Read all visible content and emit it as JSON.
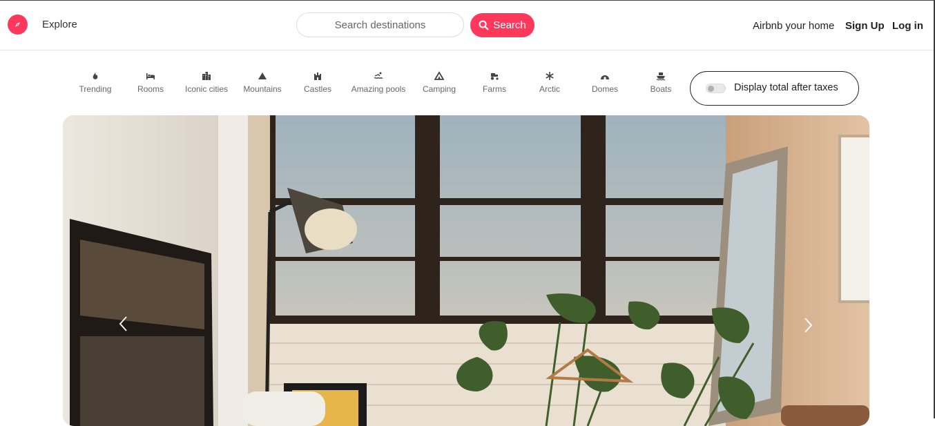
{
  "header": {
    "logo_icon": "compass-icon",
    "explore_label": "Explore",
    "search": {
      "placeholder": "Search destinations",
      "value": "",
      "button_label": "Search",
      "button_icon": "search-icon"
    },
    "host_link": "Airbnb your home",
    "signup_label": "Sign Up",
    "login_label": "Log in"
  },
  "categories": [
    {
      "label": "Trending",
      "icon": "fire-icon"
    },
    {
      "label": "Rooms",
      "icon": "bed-icon"
    },
    {
      "label": "Iconic cities",
      "icon": "city-icon"
    },
    {
      "label": "Mountains",
      "icon": "mountain-icon"
    },
    {
      "label": "Castles",
      "icon": "castle-icon"
    },
    {
      "label": "Amazing pools",
      "icon": "pool-icon"
    },
    {
      "label": "Camping",
      "icon": "tent-icon"
    },
    {
      "label": "Farms",
      "icon": "tractor-icon"
    },
    {
      "label": "Arctic",
      "icon": "snowflake-icon"
    },
    {
      "label": "Domes",
      "icon": "igloo-icon"
    },
    {
      "label": "Boats",
      "icon": "ship-icon"
    }
  ],
  "tax_toggle": {
    "label": "Display total after taxes",
    "enabled": false
  },
  "hero": {
    "image_subject": "sunlit interior room with large window, floor lamp, mirror and plants",
    "prev_icon": "chevron-left-icon",
    "next_icon": "chevron-right-icon"
  },
  "colors": {
    "brand": "#ff385c",
    "text": "#222222",
    "muted": "#666666",
    "border": "#dddddd"
  }
}
